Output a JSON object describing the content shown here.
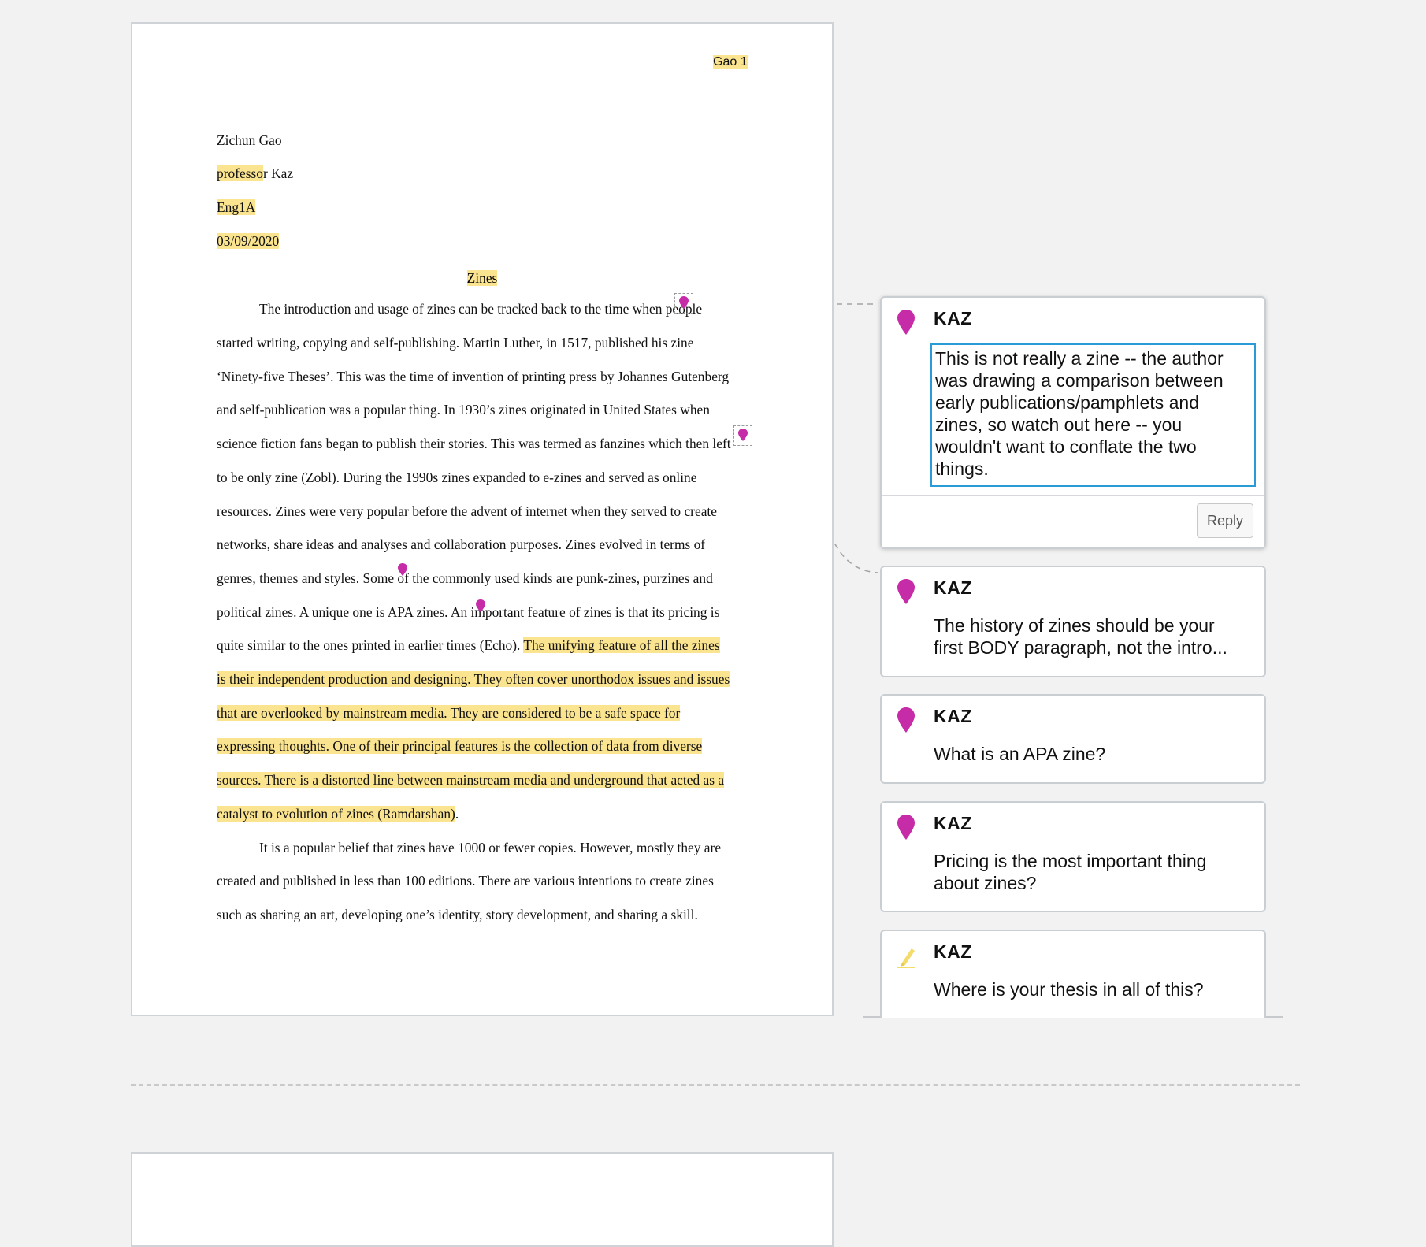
{
  "document": {
    "page_number_label": "Gao 1",
    "header_lines": [
      "Zichun Gao",
      "professor Kaz",
      "Eng1A",
      "03/09/2020"
    ],
    "title": "Zines",
    "paragraph1": [
      "The introduction and usage of zines can be tracked back to the time when people",
      "started writing, copying and self-publishing. Martin Luther, in 1517, published his zine",
      "‘Ninety-five Theses’. This was the time of invention of printing press by Johannes Gutenberg",
      "and self-publication was a popular thing. In 1930’s zines originated in United States when",
      "science fiction fans began to publish their stories. This was termed as fanzines which then left",
      "to be only zine (Zobl). During the 1990s zines expanded to e-zines and served as online",
      "resources. Zines were very popular before the advent of internet when they served to create",
      "networks, share ideas and analyses and collaboration purposes. Zines evolved in terms of",
      "genres, themes and styles. Some of the commonly used kinds are punk-zines, purzines and",
      "political zines. A unique one is APA zines. An important feature of zines is that its pricing is"
    ],
    "p1_line11_plain": "quite similar to the ones printed in earlier times (Echo). ",
    "p1_line11_hl": "The unifying feature of all the zines",
    "p1_highlighted_lines": [
      "is their independent production and designing. They often cover unorthodox issues and issues",
      "that are overlooked by mainstream media. They are considered to be a safe space for",
      "expressing thoughts. One of their principal features is the collection of data from diverse",
      "sources. There is a distorted line between mainstream media and underground that acted as a",
      "catalyst to evolution of zines (Ramdarshan)"
    ],
    "p1_end": ".",
    "paragraph2": [
      "It is a popular belief that zines have 1000 or fewer copies. However, mostly they are",
      "created and published in less than 100 editions. There are various intentions to create zines",
      "such as sharing an art, developing one’s identity, story development, and sharing a skill."
    ]
  },
  "annotations": [
    {
      "author": "KAZ",
      "type": "comment",
      "text": "This is not really a zine -- the author was drawing a comparison between early publications/pamphlets and zines, so watch out here -- you wouldn't want to conflate the two things."
    },
    {
      "author": "KAZ",
      "type": "comment",
      "text": "The history of zines should be your first BODY paragraph, not the intro..."
    },
    {
      "author": "KAZ",
      "type": "comment",
      "text": "What is an APA zine?"
    },
    {
      "author": "KAZ",
      "type": "comment",
      "text": "Pricing is the most important thing about zines?"
    },
    {
      "author": "KAZ",
      "type": "highlight",
      "text": "Where is your thesis in all of this?"
    }
  ],
  "reply_label": "Reply",
  "colors": {
    "pin": "#c62ba8",
    "highlight": "#fbe48f",
    "focus": "#2a9bd6",
    "highlight_icon": "#f3dc6a"
  }
}
